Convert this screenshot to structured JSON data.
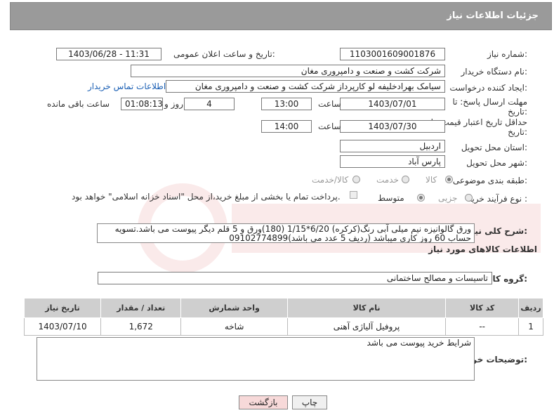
{
  "header": {
    "title": "جزئیات اطلاعات نیاز"
  },
  "fields": {
    "need_number_label": "شماره نیاز:",
    "need_number": "1103001609001876",
    "announce_label": "تاریخ و ساعت اعلان عمومی:",
    "announce_value": "1403/06/28 - 11:31",
    "buyer_org_label": "نام دستگاه خریدار:",
    "buyer_org": "شرکت کشت و صنعت و دامپروری مغان",
    "creator_label": "ایجاد کننده درخواست:",
    "creator": "سیامک بهرادخلیفه لو کارپرداز شرکت کشت و صنعت و دامپروری مغان",
    "contact_link": "اطلاعات تماس خریدار",
    "reply_deadline_label": "مهلت ارسال پاسخ: تا",
    "reply_deadline_label2": "تاریخ:",
    "reply_date": "1403/07/01",
    "time_label": "ساعت",
    "reply_time": "13:00",
    "days_value": "4",
    "days_label": "روز و",
    "remaining_time": "01:08:13",
    "remaining_label": "ساعت باقی مانده",
    "price_validity_label": "حداقل تاریخ اعتبار قیمت: تا",
    "price_validity_label2": "تاریخ:",
    "price_date": "1403/07/30",
    "price_time": "14:00",
    "province_label": "استان محل تحویل:",
    "province": "اردبیل",
    "city_label": "شهر محل تحویل:",
    "city": "پارس آباد",
    "category_label": "طبقه بندی موضوعی:",
    "category_options": [
      "کالا",
      "خدمت",
      "کالا/خدمت"
    ],
    "purchase_type_label": "نوع فرآیند خرید :",
    "purchase_options": [
      "جزیی",
      "متوسط"
    ],
    "payment_note": "پرداخت تمام یا بخشی از مبلغ خرید،از محل \"اسناد خزانه اسلامی\" خواهد بود.",
    "description_label": "شرح کلی نیاز:",
    "description": "ورق گالوانیزه نیم میلی آبی رنگ(کرکره) 6/20*1/15 (180)ورق و 5 قلم دیگر پیوست می باشد.تسویه حساب 60 روز کاری میباشد (ردیف 5 عدد می باشد)09102774899",
    "goods_info_title": "اطلاعات کالاهای مورد نیاز",
    "goods_group_label": "گروه کالا:",
    "goods_group": "تاسیسات و مصالح ساختمانی",
    "buyer_notes_label": "توضیحات خریدار:",
    "buyer_notes": "شرایط خرید پیوست می باشد"
  },
  "table": {
    "headers": [
      "ردیف",
      "کد کالا",
      "نام کالا",
      "واحد شمارش",
      "تعداد / مقدار",
      "تاریخ نیاز"
    ],
    "rows": [
      [
        "1",
        "--",
        "پروفیل آلیاژی آهنی",
        "شاخه",
        "1,672",
        "1403/07/10"
      ]
    ]
  },
  "buttons": {
    "print": "چاپ",
    "back": "بازگشت"
  },
  "colors": {
    "header_bg": "#9a9a9a",
    "link": "#1a5fb4",
    "back_btn_bg": "#f7d9d9"
  }
}
